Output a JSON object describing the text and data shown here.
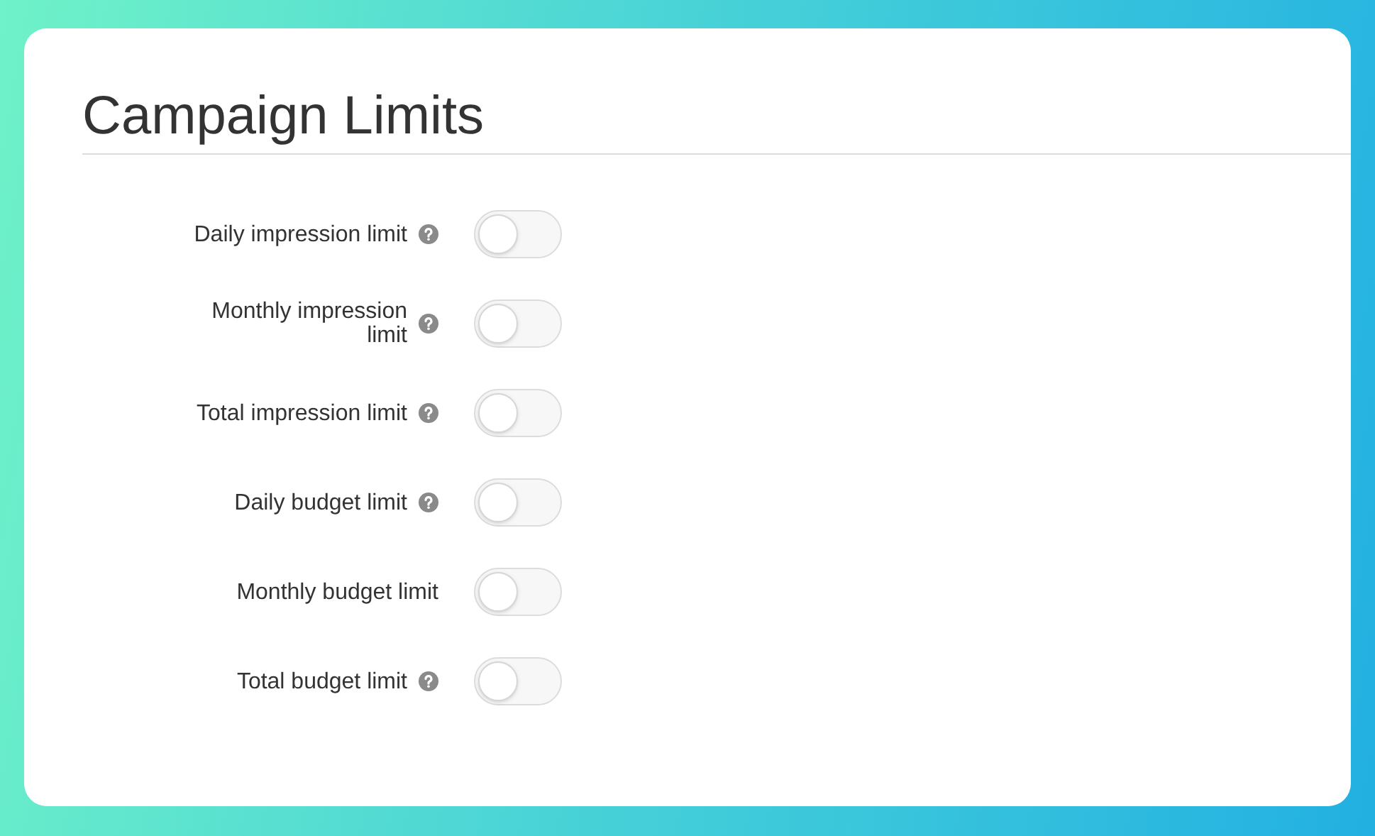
{
  "title": "Campaign Limits",
  "limits": [
    {
      "label": "Daily impression limit",
      "help": true,
      "on": false
    },
    {
      "label": "Monthly impression limit",
      "help": true,
      "on": false
    },
    {
      "label": "Total impression limit",
      "help": true,
      "on": false
    },
    {
      "label": "Daily budget limit",
      "help": true,
      "on": false
    },
    {
      "label": "Monthly budget limit",
      "help": false,
      "on": false
    },
    {
      "label": "Total budget limit",
      "help": true,
      "on": false
    }
  ]
}
